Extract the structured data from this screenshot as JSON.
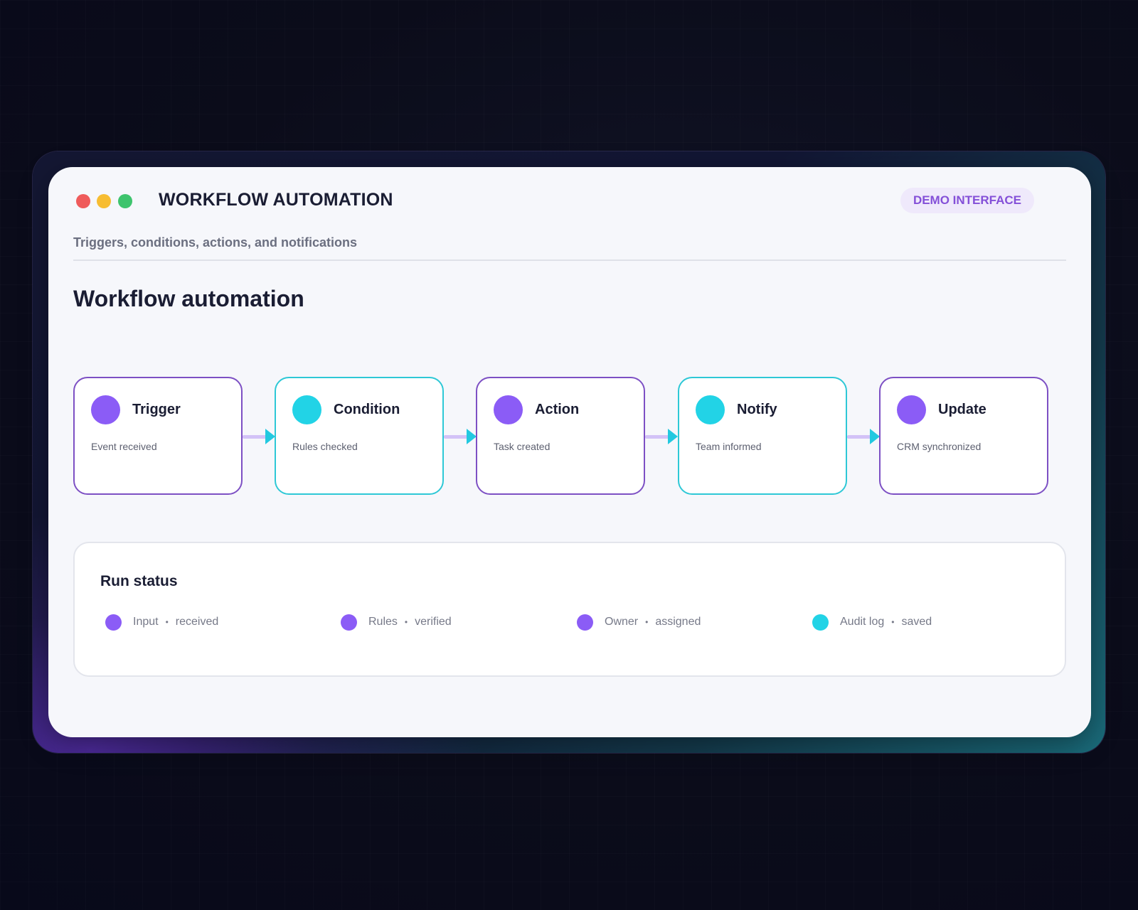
{
  "window": {
    "app_title": "WORKFLOW AUTOMATION",
    "badge": "DEMO INTERFACE",
    "subtitle": "Triggers, conditions, actions, and notifications"
  },
  "page": {
    "title": "Workflow automation"
  },
  "flow": {
    "steps": [
      {
        "title": "Trigger",
        "description": "Event received",
        "color": "#8b5cf6"
      },
      {
        "title": "Condition",
        "description": "Rules checked",
        "color": "#22d3e6"
      },
      {
        "title": "Action",
        "description": "Task created",
        "color": "#8b5cf6"
      },
      {
        "title": "Notify",
        "description": "Team informed",
        "color": "#22d3e6"
      },
      {
        "title": "Update",
        "description": "CRM synchronized",
        "color": "#8b5cf6"
      }
    ]
  },
  "run_status": {
    "title": "Run status",
    "items": [
      {
        "label": "Input",
        "separator": "•",
        "state": "received",
        "color": "#8b5cf6"
      },
      {
        "label": "Rules",
        "separator": "•",
        "state": "verified",
        "color": "#8b5cf6"
      },
      {
        "label": "Owner",
        "separator": "•",
        "state": "assigned",
        "color": "#8b5cf6"
      },
      {
        "label": "Audit log",
        "separator": "•",
        "state": "saved",
        "color": "#22d3e6"
      }
    ]
  },
  "colors": {
    "accent_purple": "#8b5cf6",
    "accent_cyan": "#22d3e6",
    "close": "#ef5b5b",
    "minimize": "#f7bd32",
    "maximize": "#3ec46d"
  }
}
